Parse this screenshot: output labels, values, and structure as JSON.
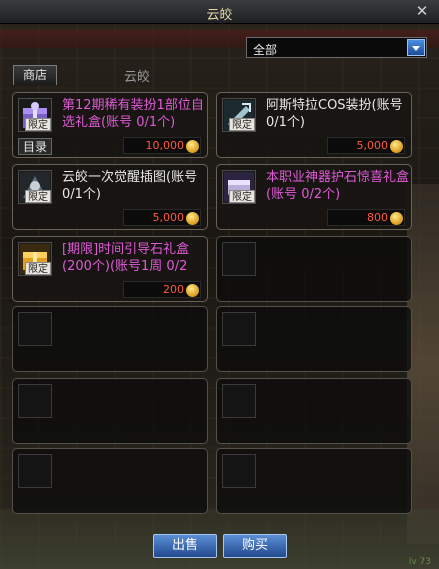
{
  "window": {
    "title": "云皎",
    "close_label": "✕"
  },
  "filter": {
    "selected": "全部"
  },
  "tabs": {
    "shop": "商店",
    "current": "云皎"
  },
  "items": [
    {
      "name": "第12期稀有装扮1部位自选礼盒(账号 0/1个)",
      "badge": "限定",
      "price": "10,000",
      "color": "pink",
      "icon": "gift-box-icon",
      "catalog": "目录"
    },
    {
      "name": "阿斯特拉COS装扮(账号 0/1个)",
      "badge": "限定",
      "price": "5,000",
      "color": "white",
      "icon": "costume-icon"
    },
    {
      "name": "云皎一次觉醒插图(账号 0/1个)",
      "badge": "限定",
      "price": "5,000",
      "color": "white",
      "icon": "illustration-icon"
    },
    {
      "name": "本职业神器护石惊喜礼盒(账号 0/2个)",
      "badge": "限定",
      "price": "800",
      "color": "pink",
      "icon": "artifact-box-icon"
    },
    {
      "name": "[期限]时间引导石礼盒(200个)(账号1周 0/2",
      "badge": "限定",
      "price": "200",
      "color": "pink",
      "icon": "stone-box-icon"
    }
  ],
  "buttons": {
    "sell": "出售",
    "buy": "购买"
  },
  "colors": {
    "pink_text": "#e05ad8",
    "price_red": "#ff5a3c",
    "button_blue": "#3a6cb8"
  },
  "footer": {
    "corner": "lv 73"
  }
}
